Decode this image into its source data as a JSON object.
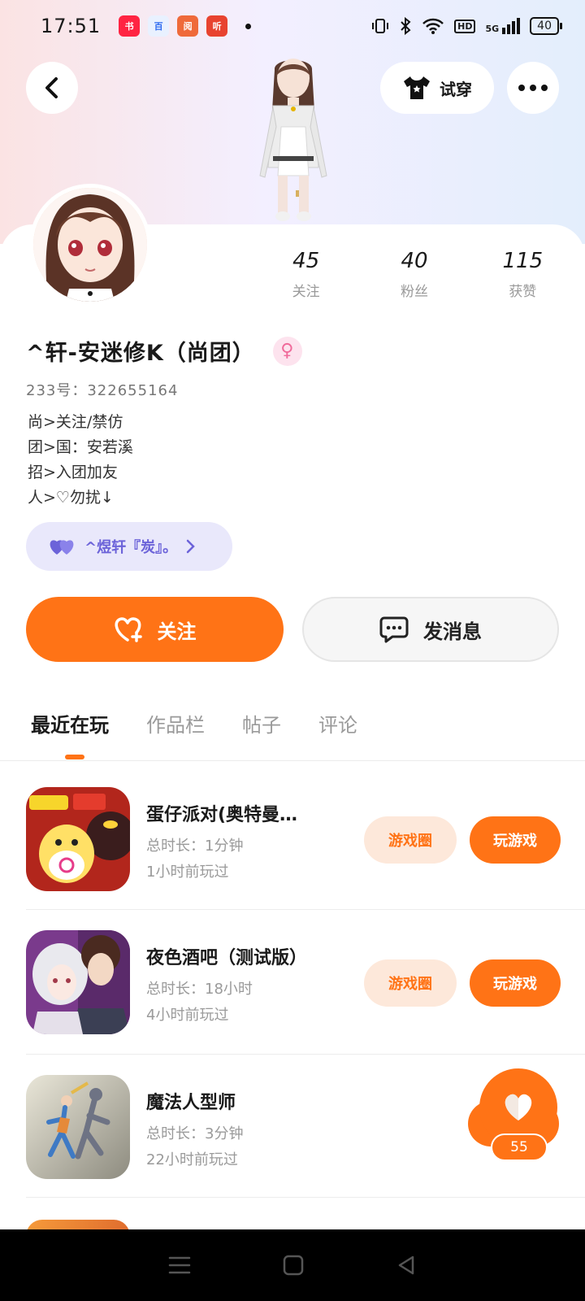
{
  "status_bar": {
    "time": "17:51",
    "apps": [
      {
        "name": "xiaohongshu-app-icon",
        "label": "小红书",
        "color": "#ff2442"
      },
      {
        "name": "baidu-app-icon",
        "label": "百",
        "color": "#2f6bf0"
      },
      {
        "name": "reader-app-icon",
        "label": "阅",
        "color": "#ef6a3a"
      },
      {
        "name": "ting-app-icon",
        "label": "听",
        "color": "#e8432f"
      }
    ],
    "network_label": "5G",
    "hd_label": "HD",
    "battery": "40"
  },
  "header": {
    "tryon_label": "试穿"
  },
  "profile": {
    "stats": [
      {
        "value": "45",
        "label": "关注"
      },
      {
        "value": "40",
        "label": "粉丝"
      },
      {
        "value": "115",
        "label": "获赞"
      }
    ],
    "nickname": "^轩-安迷修K（尚团）",
    "gender_symbol": "♀",
    "uid": "233号：322655164",
    "bio_lines": [
      "尚>关注/禁仿",
      "团>国：安若溪",
      "招>入团加友",
      "人>♡勿扰↓"
    ],
    "guild_label": "^煜轩『炭』。"
  },
  "actions": {
    "follow_label": "关注",
    "message_label": "发消息"
  },
  "tabs": [
    "最近在玩",
    "作品栏",
    "帖子",
    "评论"
  ],
  "games": [
    {
      "name": "蛋仔派对(奥特曼…",
      "duration": "总时长：1分钟",
      "last_played": "1小时前玩过",
      "circle_label": "游戏圈",
      "play_label": "玩游戏"
    },
    {
      "name": "夜色酒吧（测试版）",
      "duration": "总时长：18小时",
      "last_played": "4小时前玩过",
      "circle_label": "游戏圈",
      "play_label": "玩游戏"
    },
    {
      "name": "魔法人型师",
      "duration": "总时长：3分钟",
      "last_played": "22小时前玩过",
      "circle_label": "",
      "play_label": ""
    }
  ],
  "like_button": {
    "count": "55"
  },
  "colors": {
    "accent": "#ff7316",
    "accent_soft": "#fde8da",
    "guild": "#6c63d9"
  }
}
